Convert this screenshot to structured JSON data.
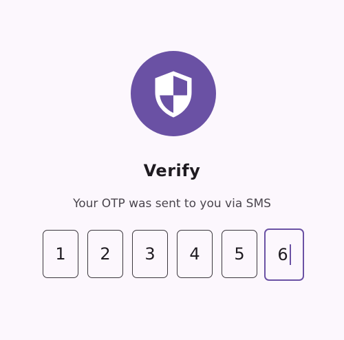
{
  "header": {
    "icon": "shield-icon",
    "icon_color": "#6a51a4",
    "title": "Verify",
    "subtitle": "Your OTP was sent to you via SMS"
  },
  "otp": {
    "digits": [
      "1",
      "2",
      "3",
      "4",
      "5",
      "6"
    ],
    "focused_index": 5,
    "accent": "#6a51a4"
  }
}
